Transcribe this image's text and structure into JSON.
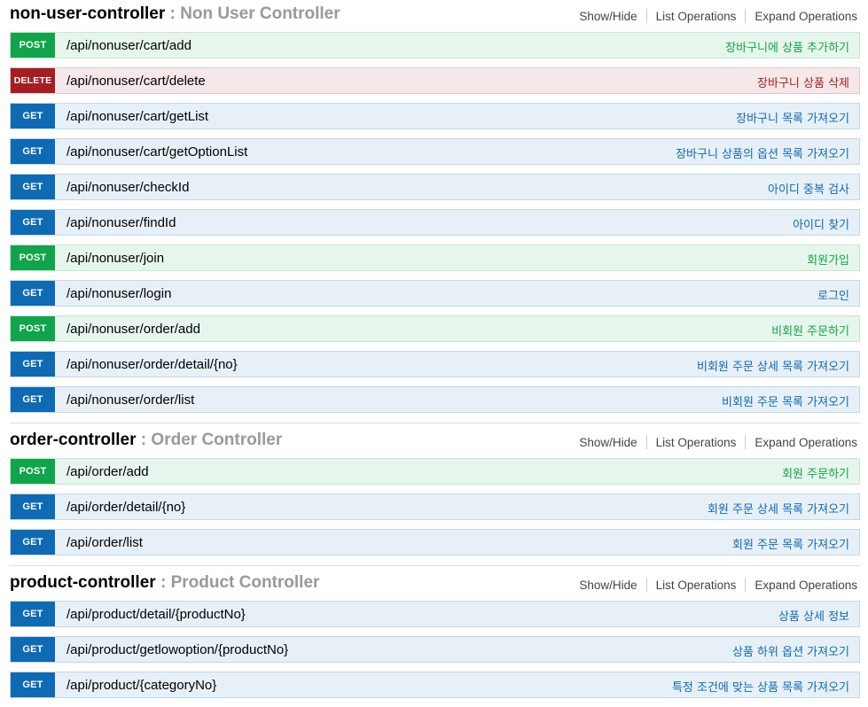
{
  "colors": {
    "get": "#0f6ab4",
    "post": "#10a54a",
    "delete": "#a41e22"
  },
  "header_links": {
    "show_hide": "Show/Hide",
    "list_operations": "List Operations",
    "expand_operations": "Expand Operations"
  },
  "controllers": [
    {
      "name": "non-user-controller",
      "separator": " : ",
      "description": "Non User Controller",
      "ops": [
        {
          "method": "POST",
          "path": "/api/nonuser/cart/add",
          "summary": "장바구니에 상품 추가하기"
        },
        {
          "method": "DELETE",
          "path": "/api/nonuser/cart/delete",
          "summary": "장바구니 상품 삭제"
        },
        {
          "method": "GET",
          "path": "/api/nonuser/cart/getList",
          "summary": "장바구니 목록 가져오기"
        },
        {
          "method": "GET",
          "path": "/api/nonuser/cart/getOptionList",
          "summary": "장바구니 상품의 옵션 목록 가져오기"
        },
        {
          "method": "GET",
          "path": "/api/nonuser/checkId",
          "summary": "아이디 중복 검사"
        },
        {
          "method": "GET",
          "path": "/api/nonuser/findId",
          "summary": "아이디 찾기"
        },
        {
          "method": "POST",
          "path": "/api/nonuser/join",
          "summary": "회원가입"
        },
        {
          "method": "GET",
          "path": "/api/nonuser/login",
          "summary": "로그인"
        },
        {
          "method": "POST",
          "path": "/api/nonuser/order/add",
          "summary": "비회원 주문하기"
        },
        {
          "method": "GET",
          "path": "/api/nonuser/order/detail/{no}",
          "summary": "비회원 주문 상세 목록 가져오기"
        },
        {
          "method": "GET",
          "path": "/api/nonuser/order/list",
          "summary": "비회원 주문 목록 가져오기"
        }
      ]
    },
    {
      "name": "order-controller",
      "separator": " : ",
      "description": "Order Controller",
      "ops": [
        {
          "method": "POST",
          "path": "/api/order/add",
          "summary": "회원 주문하기"
        },
        {
          "method": "GET",
          "path": "/api/order/detail/{no}",
          "summary": "회원 주문 상세 목록 가져오기"
        },
        {
          "method": "GET",
          "path": "/api/order/list",
          "summary": "회원 주문 목록 가져오기"
        }
      ]
    },
    {
      "name": "product-controller",
      "separator": " : ",
      "description": "Product Controller",
      "ops": [
        {
          "method": "GET",
          "path": "/api/product/detail/{productNo}",
          "summary": "상품 상세 정보"
        },
        {
          "method": "GET",
          "path": "/api/product/getlowoption/{productNo}",
          "summary": "상품 하위 옵션 가져오기"
        },
        {
          "method": "GET",
          "path": "/api/product/{categoryNo}",
          "summary": "특정 조건에 맞는 상품 목록 가져오기"
        }
      ]
    }
  ]
}
